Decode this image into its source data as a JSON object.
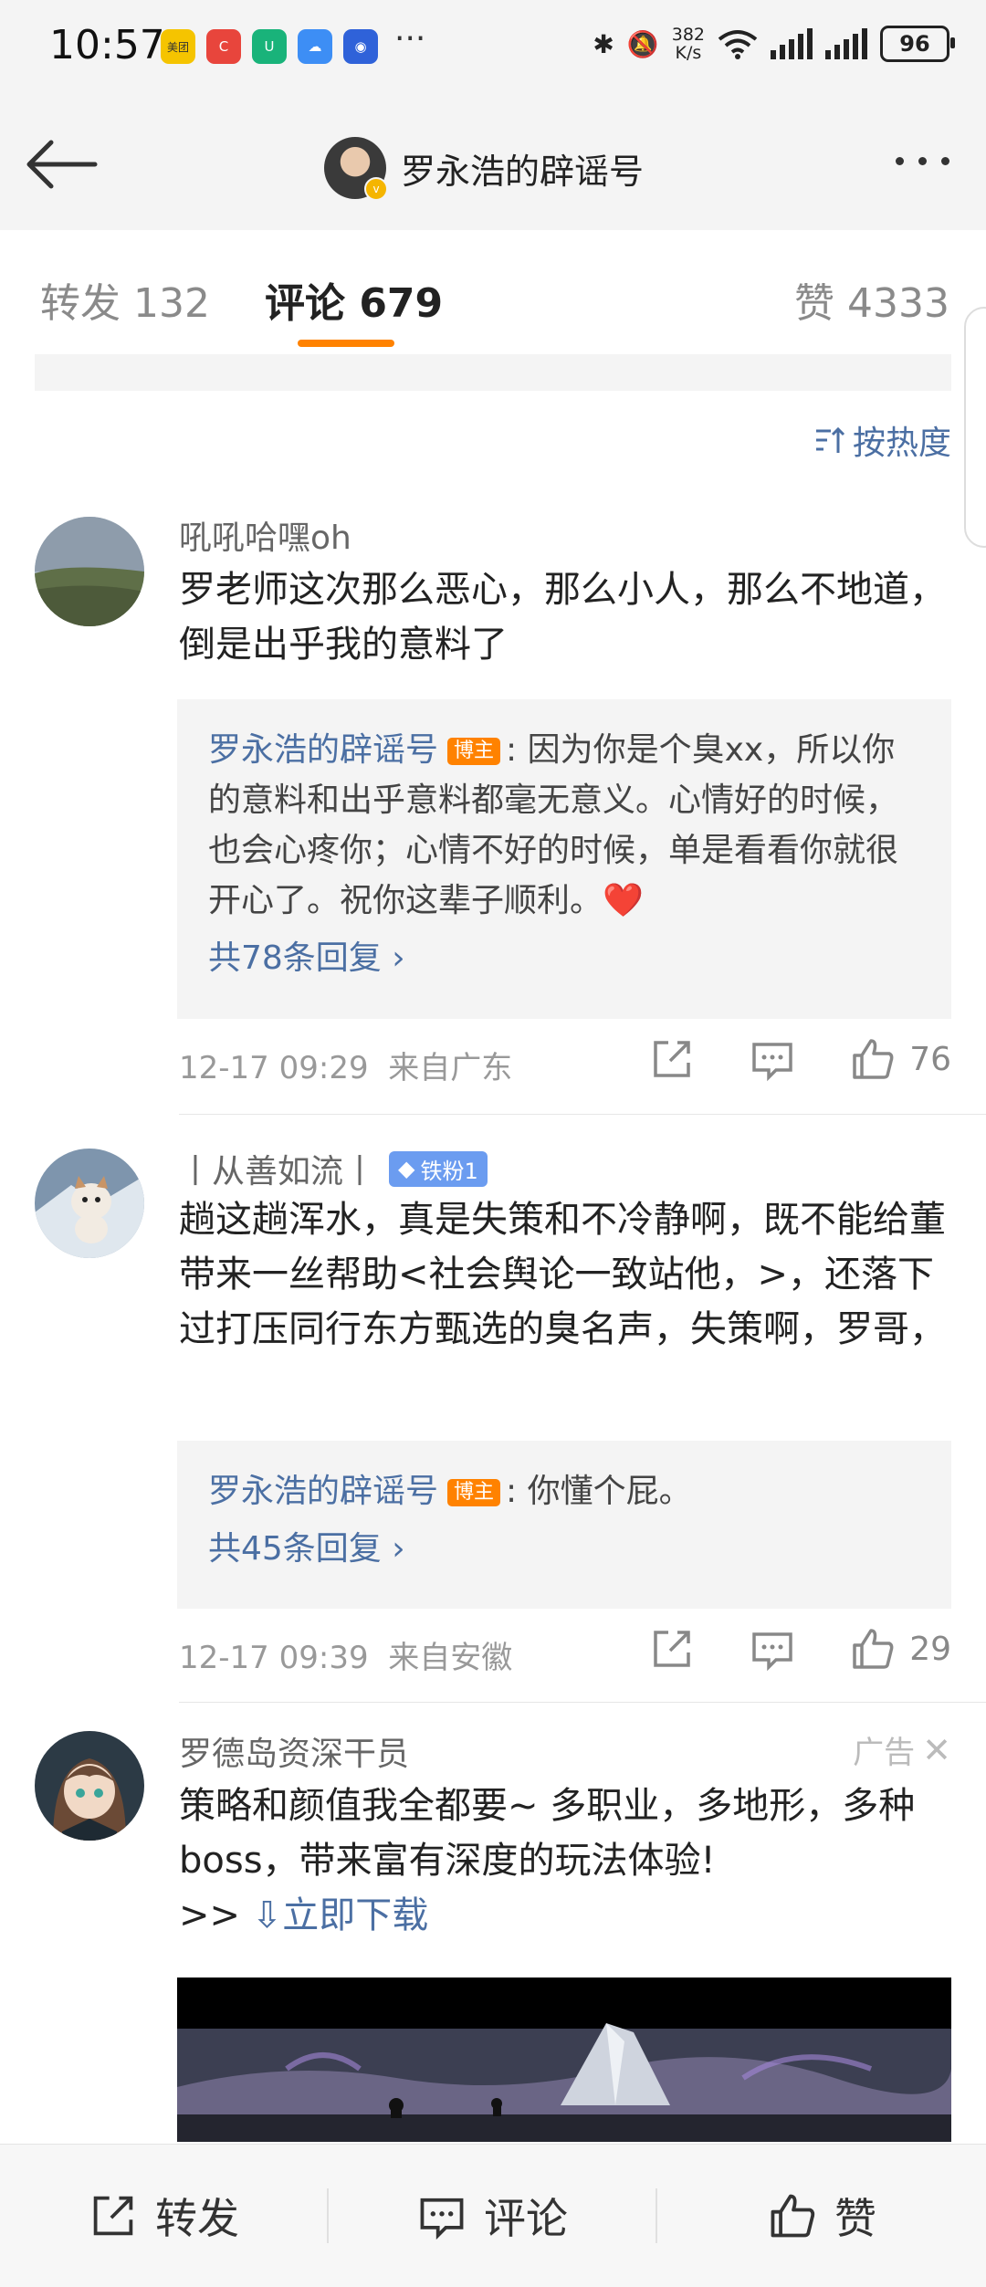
{
  "status_bar": {
    "time": "10:57",
    "apps": [
      {
        "icon": "meituan-app-icon",
        "label": "美团",
        "color": "#f5c400"
      },
      {
        "icon": "red-app-icon",
        "label": "C",
        "color": "#e8453c"
      },
      {
        "icon": "green-app-icon",
        "label": "U",
        "color": "#19b37a"
      },
      {
        "icon": "cloud-app-icon",
        "label": "☁",
        "color": "#3d8ef5"
      },
      {
        "icon": "blue-app-icon",
        "label": "◉",
        "color": "#2f62d9"
      }
    ],
    "more": "···",
    "net_speed_value": "382",
    "net_speed_unit": "K/s",
    "battery": "96"
  },
  "nav": {
    "title": "罗永浩的辟谣号",
    "verified": "v"
  },
  "tabs": [
    {
      "label": "转发 132",
      "active": false
    },
    {
      "label": "评论 679",
      "active": true
    },
    {
      "label": "赞 4333",
      "active": false
    }
  ],
  "sort": {
    "label": "按热度"
  },
  "comments": [
    {
      "name": "吼吼哈嘿oh",
      "text": "罗老师这次那么恶心，那么小人，那么不地道，倒是出乎我的意料了",
      "reply": {
        "user": "罗永浩的辟谣号",
        "badge": "博主",
        "text": ": 因为你是个臭xx，所以你的意料和出乎意料都毫无意义。心情好的时候，也会心疼你；心情不好的时候，单是看看你就很开心了。祝你这辈子顺利。",
        "emoji": "❤️",
        "more": "共78条回复 ›"
      },
      "time": "12-17 09:29",
      "location": "来自广东",
      "likes": "76"
    },
    {
      "name": "丨从善如流丨",
      "fan_badge": "铁粉1",
      "text": "趟这趟浑水，真是失策和不冷静啊，既不能给董带来一丝帮助<社会舆论一致站他，>，还落下过打压同行东方甄选的臭名声，失策啊，罗哥，",
      "reply": {
        "user": "罗永浩的辟谣号",
        "badge": "博主",
        "text": ": 你懂个屁。",
        "more": "共45条回复 ›"
      },
      "time": "12-17 09:39",
      "location": "来自安徽",
      "likes": "29"
    }
  ],
  "ad": {
    "name": "罗德岛资深干员",
    "label": "广告",
    "text": "策略和颜值我全都要~ 多职业，多地形，多种boss，带来富有深度的玩法体验!",
    "prefix": ">>",
    "download": "⇩立即下载"
  },
  "bottom_bar": {
    "repost": "转发",
    "comment": "评论",
    "like": "赞"
  }
}
